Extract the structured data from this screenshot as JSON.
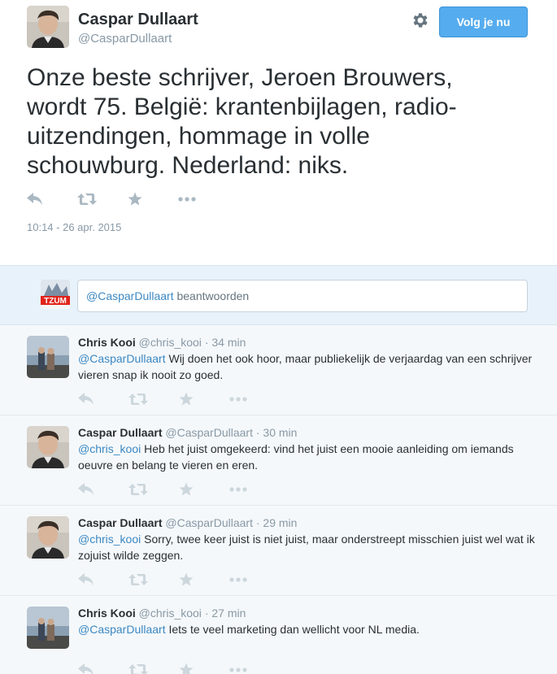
{
  "tweet": {
    "author_name": "Caspar Dullaart",
    "author_handle": "@CasparDullaart",
    "follow_label": "Volg je nu",
    "text": "Onze beste schrijver, Jeroen Brouwers, wordt 75. België: krantenbijlagen, radio-uitzendingen, hommage in volle schouwburg. Nederland: niks.",
    "timestamp": "10:14 - 26 apr. 2015",
    "icons": [
      "reply-icon",
      "retweet-icon",
      "favorite-icon",
      "more-icon",
      "gear-icon"
    ]
  },
  "reply_box": {
    "avatar_text": "TZUM",
    "mention": "@CasparDullaart",
    "placeholder_rest": " beantwoorden"
  },
  "replies": [
    {
      "name": "Chris Kooi",
      "handle": "@chris_kooi",
      "dot": "·",
      "time": "34 min",
      "mention": "@CasparDullaart",
      "text": " Wij doen het ook hoor, maar publiekelijk de verjaardag van een schrijver vieren snap ik nooit zo goed.",
      "avatar": "chris"
    },
    {
      "name": "Caspar Dullaart",
      "handle": "@CasparDullaart",
      "dot": "·",
      "time": "30 min",
      "mention": "@chris_kooi",
      "text": " Heb het juist omgekeerd: vind het juist een mooie aanleiding om iemands oeuvre en belang te vieren en eren.",
      "avatar": "caspar"
    },
    {
      "name": "Caspar Dullaart",
      "handle": "@CasparDullaart",
      "dot": "·",
      "time": "29 min",
      "mention": "@chris_kooi",
      "text": " Sorry, twee keer juist is niet juist, maar onderstreept misschien juist wel wat ik zojuist wilde zeggen.",
      "avatar": "caspar"
    },
    {
      "name": "Chris Kooi",
      "handle": "@chris_kooi",
      "dot": "·",
      "time": "27 min",
      "mention": "@CasparDullaart",
      "text": " Iets te veel marketing dan wellicht voor NL media.",
      "avatar": "chris"
    }
  ],
  "colors": {
    "link": "#3b88c3",
    "follow_button": "#55acee",
    "muted": "#8899a6",
    "reply_bg": "#f5f8fa",
    "reply_box_bg": "#e8f2fa"
  }
}
